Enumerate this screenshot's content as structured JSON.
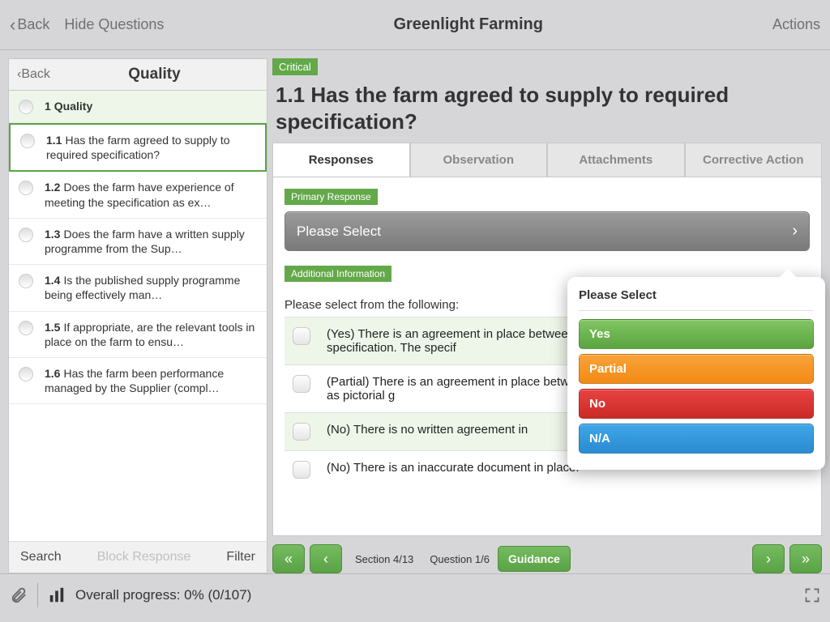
{
  "topbar": {
    "back": "Back",
    "hideQuestions": "Hide Questions",
    "title": "Greenlight Farming",
    "actions": "Actions"
  },
  "sidebar": {
    "back": "Back",
    "title": "Quality",
    "section": {
      "num": "1",
      "label": "Quality"
    },
    "items": [
      {
        "num": "1.1",
        "text": "Has the farm agreed to supply to required specification?"
      },
      {
        "num": "1.2",
        "text": "Does the farm have experience of meeting the specification as ex…"
      },
      {
        "num": "1.3",
        "text": "Does the farm have a written supply programme from the Sup…"
      },
      {
        "num": "1.4",
        "text": "Is the published supply programme being effectively man…"
      },
      {
        "num": "1.5",
        "text": "If appropriate, are the relevant tools in place on the farm to ensu…"
      },
      {
        "num": "1.6",
        "text": "Has the farm been performance managed by the Supplier (compl…"
      }
    ],
    "footer": {
      "search": "Search",
      "block": "Block Response",
      "filter": "Filter"
    }
  },
  "content": {
    "badge": "Critical",
    "question": "1.1 Has the farm agreed to supply to required specification?",
    "tabs": [
      "Responses",
      "Observation",
      "Attachments",
      "Corrective Action"
    ],
    "primaryLabel": "Primary Response",
    "selectPrompt": "Please Select",
    "addlLabel": "Additional Information",
    "hint": "Please select from the following:",
    "options": [
      "(Yes) There is an agreement in place between the farm and the appropriate specification.  The specif",
      "(Partial) There is an agreement in place between the farm and there are elements such as pictorial g",
      "(No) There is no written agreement in",
      "(No) There is an inaccurate document in place."
    ]
  },
  "nav": {
    "section": "Section 4/13",
    "question": "Question 1/6",
    "guidance": "Guidance"
  },
  "popover": {
    "title": "Please Select",
    "buttons": {
      "yes": "Yes",
      "partial": "Partial",
      "no": "No",
      "na": "N/A"
    }
  },
  "bottom": {
    "progress": "Overall progress: 0% (0/107)"
  }
}
